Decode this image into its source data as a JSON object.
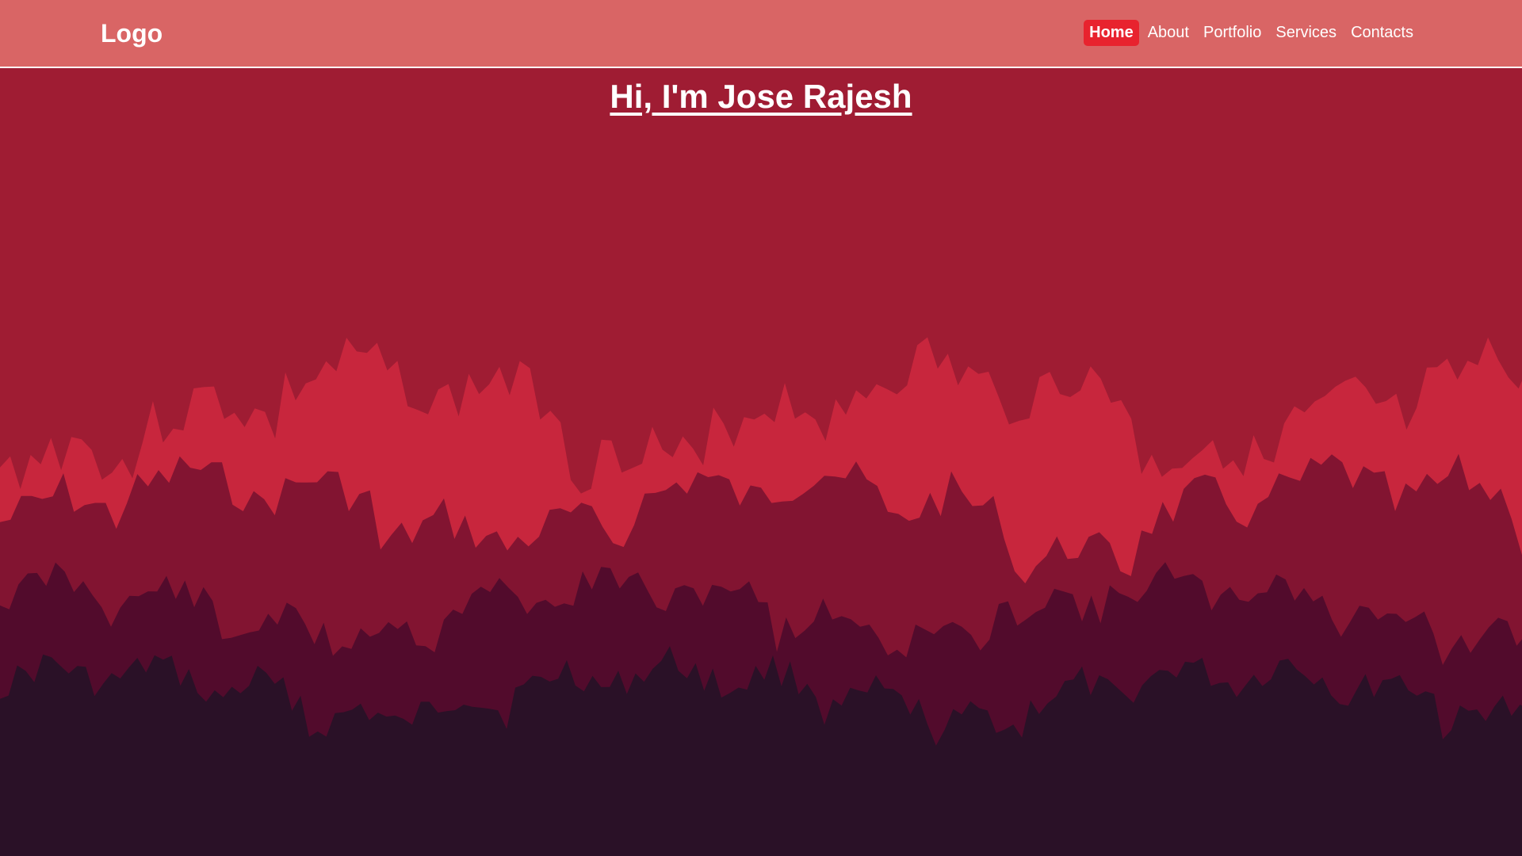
{
  "navbar": {
    "logo": "Logo",
    "links": [
      {
        "label": "Home",
        "active": true
      },
      {
        "label": "About",
        "active": false
      },
      {
        "label": "Portfolio",
        "active": false
      },
      {
        "label": "Services",
        "active": false
      },
      {
        "label": "Contacts",
        "active": false
      }
    ]
  },
  "hero": {
    "title": "Hi, I'm Jose Rajesh"
  },
  "colors": {
    "navbar_bg": "#d96565",
    "active_link_bg": "#e8232e",
    "sky": "#9f1c33",
    "forest_layer_1": "#c8263d",
    "forest_layer_2": "#821431",
    "forest_layer_3": "#520b2c",
    "forest_layer_4": "#2a1127"
  },
  "background": {
    "illustration": "forest-silhouette"
  }
}
